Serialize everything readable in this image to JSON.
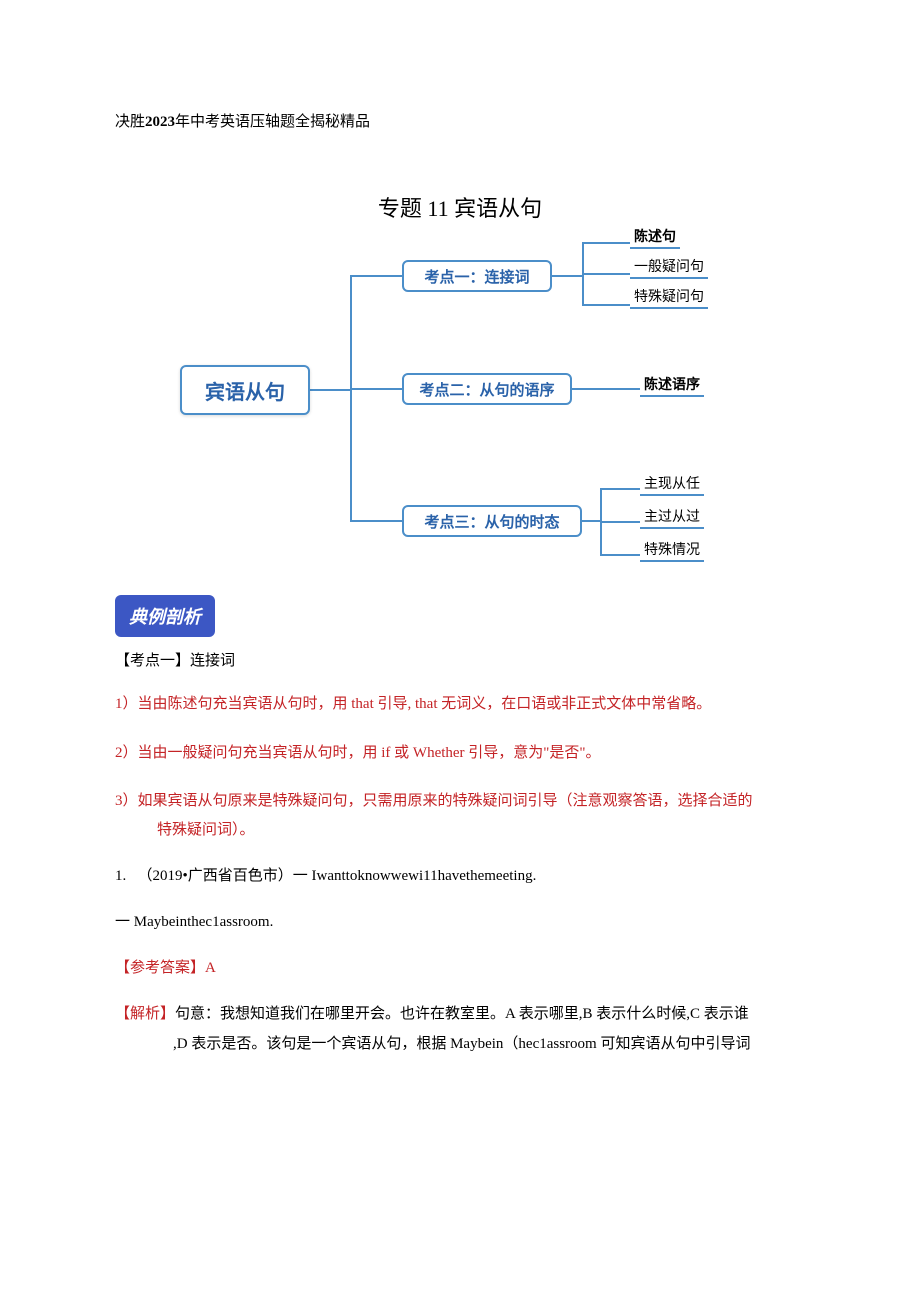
{
  "header": {
    "prefix": "决胜",
    "year": "2023",
    "suffix": "年中考英语压轴题全揭秘精品"
  },
  "topic": {
    "prefix": "专题",
    "num": "11",
    "name": "宾语从句"
  },
  "diagram": {
    "root": "宾语从句",
    "k1": {
      "label": "考点一：连接词",
      "leaves": [
        "陈述句",
        "一般疑问句",
        "特殊疑问句"
      ]
    },
    "k2": {
      "label": "考点二：从句的语序",
      "leaves": [
        "陈述语序"
      ]
    },
    "k3": {
      "label": "考点三：从句的时态",
      "leaves": [
        "主现从任",
        "主过从过",
        "特殊情况"
      ]
    }
  },
  "tag": "典例剖析",
  "kp_head": "【考点一】连接词",
  "rules": {
    "r1a": "1）当由陈述句充当宾语从句时，用 that 引导, that 无词义，在口语或非正式文体中常省略。",
    "r2": "2）当由一般疑问句充当宾语从句时，用 if 或 Whether 引导，意为\"是否\"。",
    "r3a": "3）如果宾语从句原来是特殊疑问句，只需用原来的特殊疑问词引导（注意观察答语，选择合适的",
    "r3b": "特殊疑问词）。"
  },
  "question": {
    "num": "1.",
    "src": "（2019•广西省百色市）",
    "dash": "一",
    "q_en": " Iwanttoknowwewi11havethemeeting.",
    "a_en": " Maybeinthec1assroom."
  },
  "answer": "【参考答案】A",
  "explain": {
    "label": "【解析】",
    "t1": "句意：我想知道我们在哪里开会。也许在教室里。A 表示哪里,B 表示什么时候,C 表示谁",
    "t2": ",D 表示是否。该句是一个宾语从句，根据 Maybein（hec1assroom 可知宾语从句中引导词"
  }
}
